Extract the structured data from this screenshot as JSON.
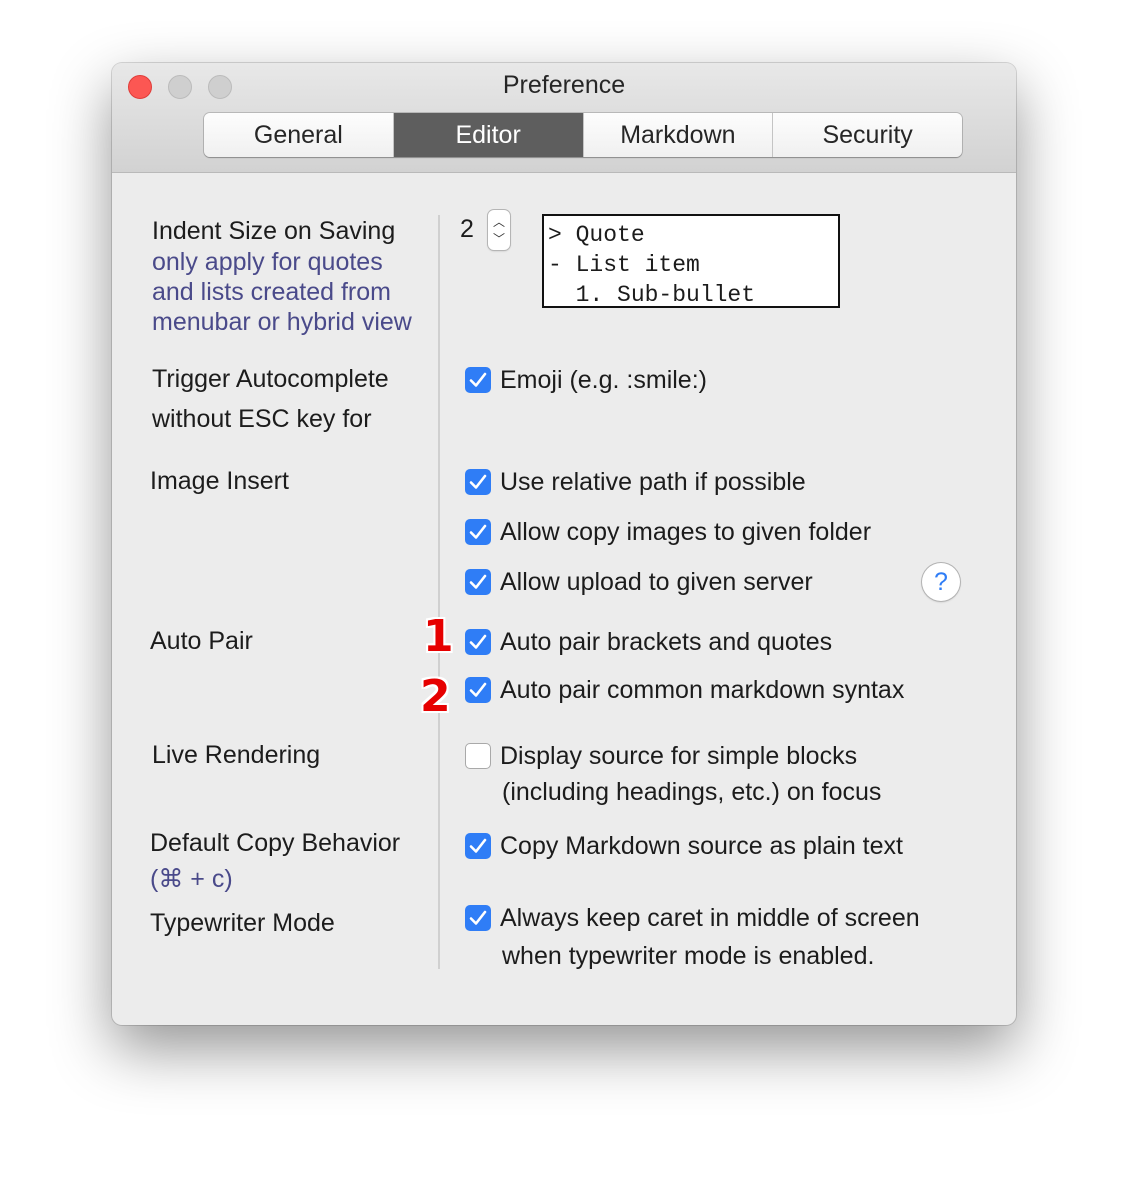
{
  "window": {
    "title": "Preference"
  },
  "tabs": [
    {
      "label": "General",
      "active": false
    },
    {
      "label": "Editor",
      "active": true
    },
    {
      "label": "Markdown",
      "active": false
    },
    {
      "label": "Security",
      "active": false
    }
  ],
  "indent": {
    "label": "Indent Size on Saving",
    "sublabel_lines": [
      "only apply for quotes",
      "and lists created from",
      "menubar or hybrid view"
    ],
    "value": "2",
    "preview_lines": [
      "> Quote",
      "- List item",
      "  1. Sub-bullet"
    ]
  },
  "autocomplete": {
    "label_lines": [
      "Trigger Autocomplete",
      "without ESC key for"
    ],
    "options": [
      {
        "label": "Emoji (e.g. :smile:)",
        "checked": true
      }
    ]
  },
  "image_insert": {
    "label": "Image Insert",
    "options": [
      {
        "label": "Use relative path if possible",
        "checked": true
      },
      {
        "label": "Allow copy images to given folder",
        "checked": true
      },
      {
        "label": "Allow upload to given server",
        "checked": true
      }
    ],
    "help": "?"
  },
  "auto_pair": {
    "label": "Auto Pair",
    "options": [
      {
        "label": "Auto pair brackets and quotes",
        "checked": true
      },
      {
        "label": "Auto pair common markdown syntax",
        "checked": true
      }
    ],
    "badges": [
      "1",
      "2"
    ]
  },
  "live_rendering": {
    "label": "Live Rendering",
    "options": [
      {
        "label_lines": [
          "Display source for simple blocks",
          "(including headings, etc.) on focus"
        ],
        "checked": false
      }
    ]
  },
  "copy_behavior": {
    "label": "Default Copy Behavior",
    "sublabel": "(⌘ + c)",
    "options": [
      {
        "label": "Copy Markdown source as plain text",
        "checked": true
      }
    ]
  },
  "typewriter": {
    "label": "Typewriter Mode",
    "options": [
      {
        "label_lines": [
          "Always keep caret in middle of screen",
          "when typewriter mode is enabled."
        ],
        "checked": true
      }
    ]
  },
  "colors": {
    "accent": "#2f7df6",
    "close": "#fc5753",
    "badge": "#e60000",
    "sublabel": "#4a4a8a"
  }
}
